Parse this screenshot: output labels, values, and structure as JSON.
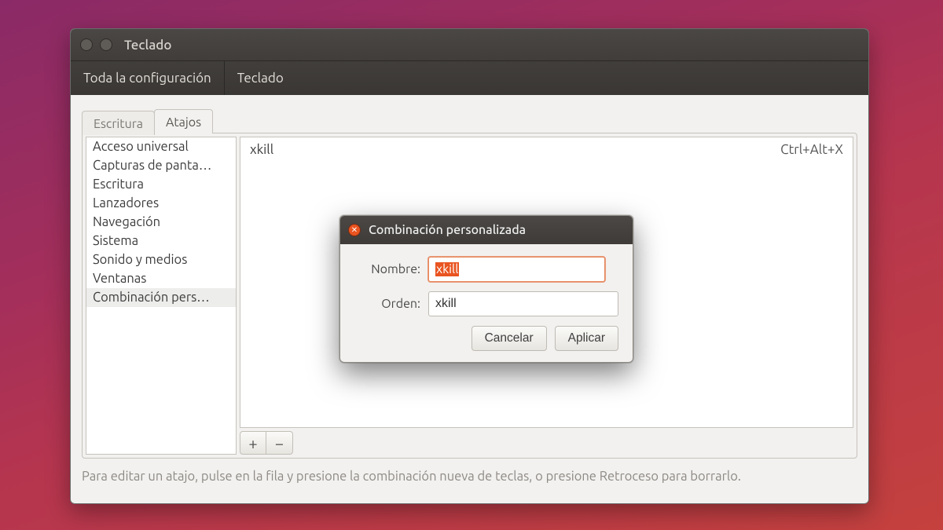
{
  "window": {
    "title": "Teclado"
  },
  "breadcrumb": {
    "all": "Toda la configuración",
    "current": "Teclado"
  },
  "tabs": {
    "writing": "Escritura",
    "shortcuts": "Atajos"
  },
  "categories": [
    "Acceso universal",
    "Capturas de panta…",
    "Escritura",
    "Lanzadores",
    "Navegación",
    "Sistema",
    "Sonido y medios",
    "Ventanas",
    "Combinación pers…"
  ],
  "selected_category_index": 8,
  "shortcuts": [
    {
      "name": "xkill",
      "keys": "Ctrl+Alt+X"
    }
  ],
  "toolbar": {
    "add": "+",
    "remove": "−"
  },
  "hint": "Para editar un atajo, pulse en la fila y presione la combinación nueva de teclas, o presione Retroceso para borrarlo.",
  "dialog": {
    "title": "Combinación personalizada",
    "name_label": "Nombre:",
    "order_label": "Orden:",
    "name_value": "xkill",
    "order_value": "xkill",
    "cancel": "Cancelar",
    "apply": "Aplicar"
  }
}
